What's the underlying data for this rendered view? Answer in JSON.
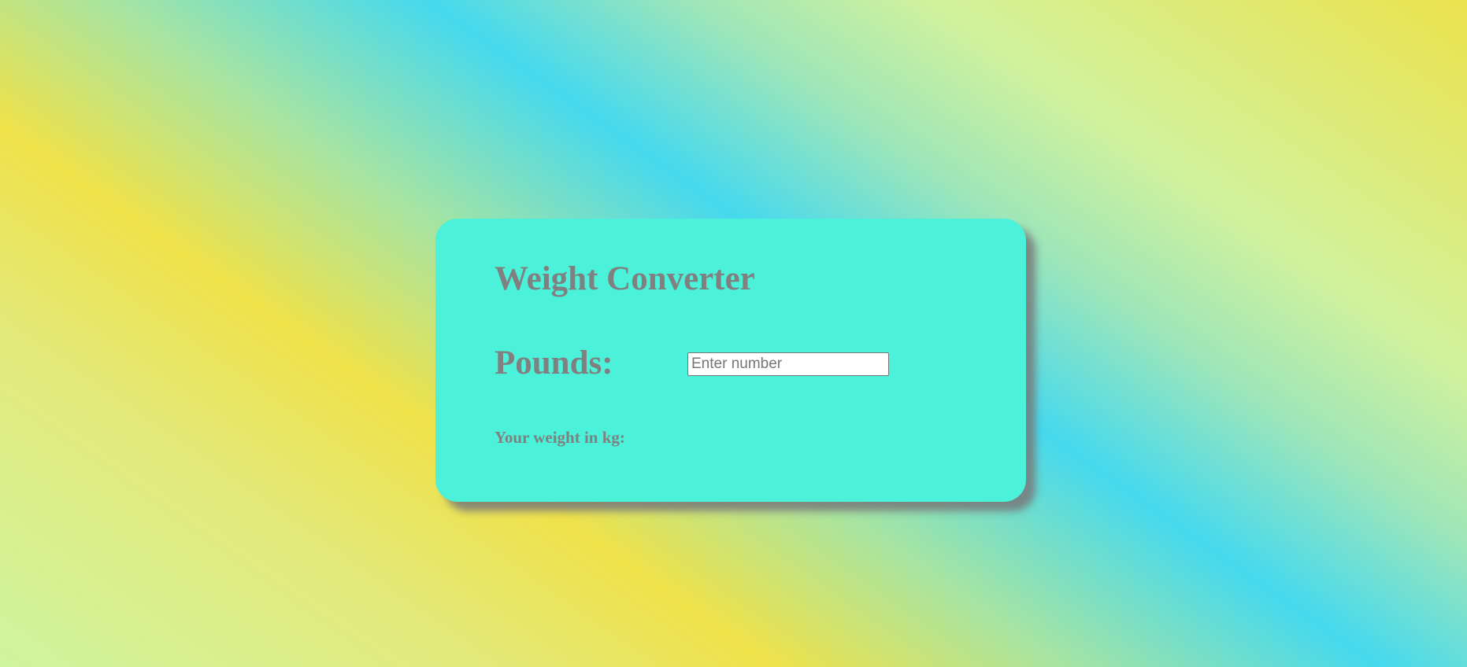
{
  "converter": {
    "title": "Weight Converter",
    "input_label": "Pounds:",
    "input_value": "",
    "input_placeholder": "Enter number",
    "result_label": "Your weight in kg:",
    "result_value": ""
  },
  "colors": {
    "card_background": "#4bf1d8",
    "text": "#808080",
    "gradient_yellow": "#efe24a",
    "gradient_cyan": "#45d9ee",
    "gradient_light_green": "#d2f29c"
  }
}
